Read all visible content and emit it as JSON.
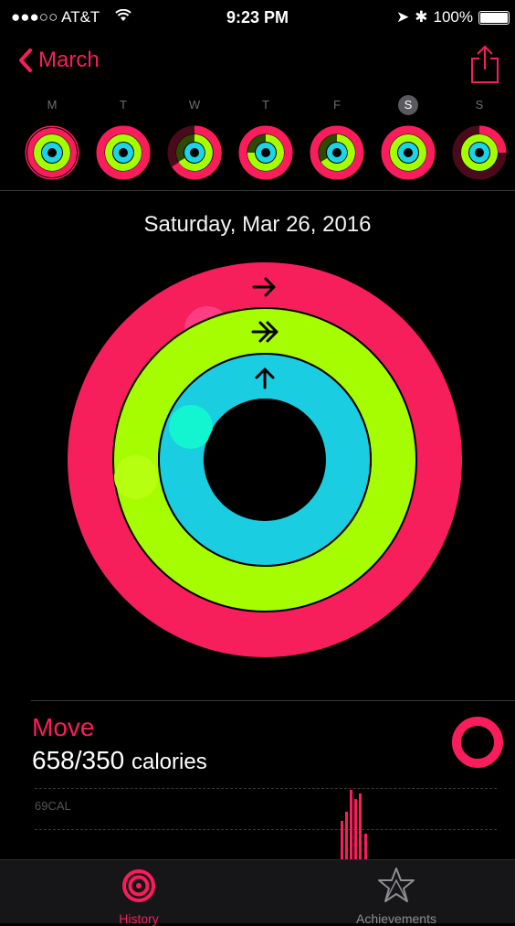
{
  "status_bar": {
    "carrier": "●●●○○ AT&T",
    "time": "9:23 PM",
    "battery": "100%"
  },
  "nav": {
    "back_label": "March"
  },
  "week": {
    "days": [
      {
        "label": "M",
        "selected": false
      },
      {
        "label": "T",
        "selected": false
      },
      {
        "label": "W",
        "selected": false
      },
      {
        "label": "T",
        "selected": false
      },
      {
        "label": "F",
        "selected": false
      },
      {
        "label": "S",
        "selected": true
      },
      {
        "label": "S",
        "selected": false
      }
    ]
  },
  "date_title": "Saturday, Mar 26, 2016",
  "rings": {
    "move_color": "#fa1d5b",
    "exercise_color": "#a6ff00",
    "stand_color": "#1cd4e8"
  },
  "move": {
    "title": "Move",
    "value": "658/350",
    "unit": "calories",
    "chart_label": "69CAL"
  },
  "tabs": {
    "history": "History",
    "achievements": "Achievements"
  },
  "colors": {
    "accent": "#fa1d5b",
    "background": "#000000"
  }
}
